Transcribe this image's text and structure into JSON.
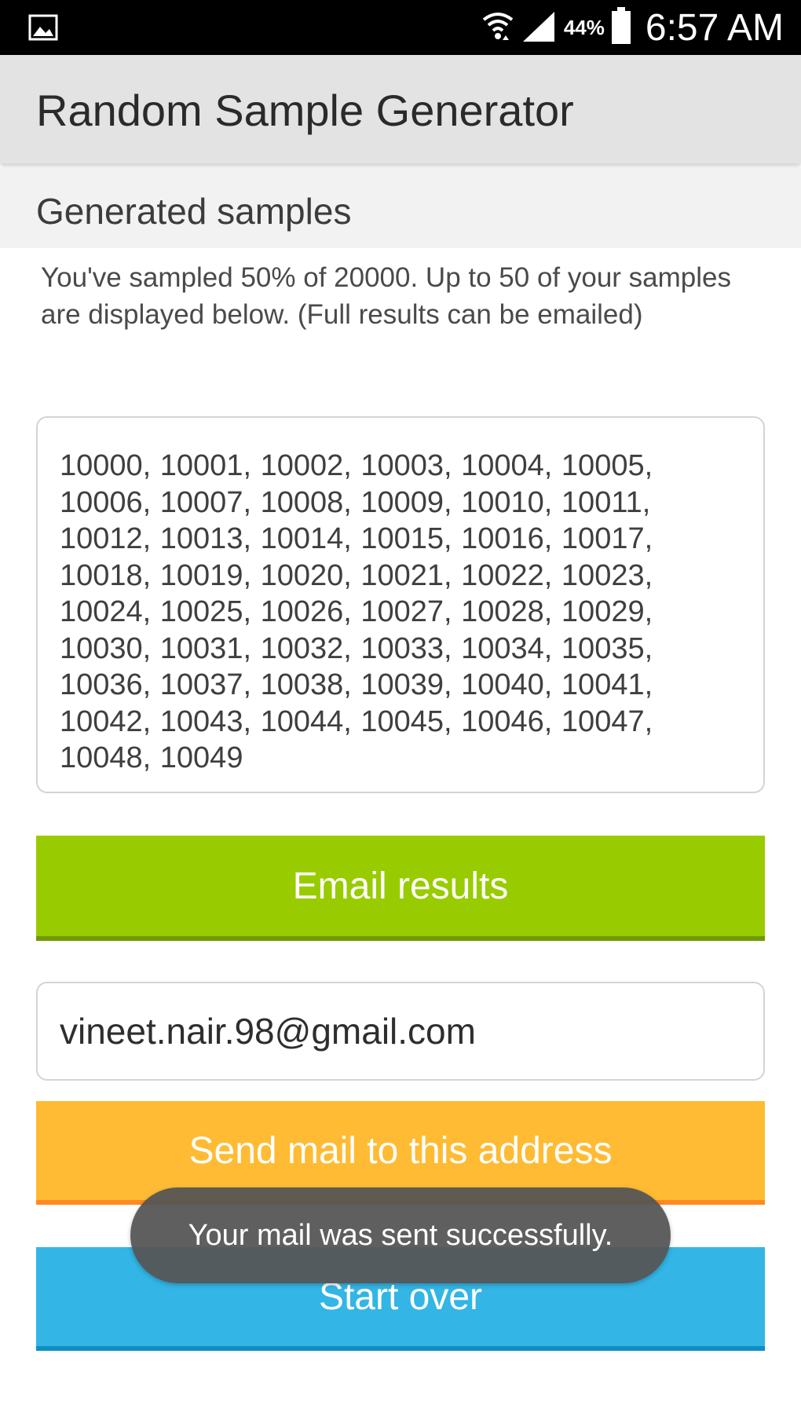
{
  "status_bar": {
    "left_icon": "image-icon",
    "icons": [
      "wifi-icon",
      "signal-icon",
      "battery-icon"
    ],
    "battery_percent": "44%",
    "time": "6:57 AM"
  },
  "action_bar": {
    "title": "Random Sample Generator"
  },
  "section": {
    "title": "Generated samples",
    "description": "You've sampled 50% of 20000. Up to 50 of your samples are displayed below. (Full results can be emailed)"
  },
  "samples": {
    "text": "10000, 10001, 10002, 10003, 10004, 10005, 10006, 10007, 10008, 10009, 10010, 10011, 10012, 10013, 10014, 10015, 10016, 10017, 10018, 10019, 10020, 10021, 10022, 10023, 10024, 10025, 10026, 10027, 10028, 10029, 10030, 10031, 10032, 10033, 10034, 10035, 10036, 10037, 10038, 10039, 10040, 10041, 10042, 10043, 10044, 10045, 10046, 10047, 10048, 10049"
  },
  "buttons": {
    "email_results": "Email results",
    "send_mail": "Send mail to this address",
    "start_over": "Start over"
  },
  "email": {
    "value": "vineet.nair.98@gmail.com"
  },
  "toast": {
    "message": "Your mail was sent successfully."
  },
  "colors": {
    "email_button": "#99cc00",
    "send_button": "#ffbb33",
    "start_button": "#33b5e5"
  }
}
